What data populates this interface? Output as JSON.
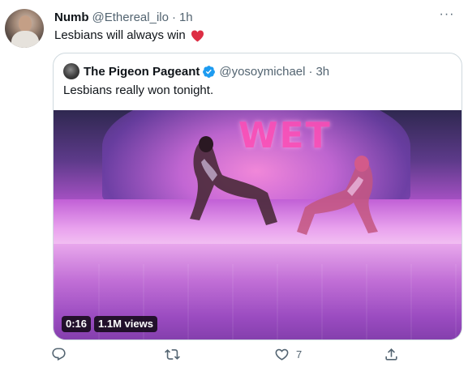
{
  "tweet": {
    "author_name": "Numb",
    "author_handle": "@Ethereal_ilo",
    "separator": "·",
    "time": "1h",
    "text": "Lesbians will always win",
    "more_glyph": "···",
    "heart_emoji_color": "#dd2e44"
  },
  "quoted_tweet": {
    "author_name": "The Pigeon Pageant",
    "author_handle": "@yosoymichael",
    "separator": "·",
    "time": "3h",
    "text": "Lesbians really won tonight.",
    "verified_color": "#1d9bf0",
    "video": {
      "duration": "0:16",
      "views": "1.1M views",
      "sign_text": "WET"
    }
  },
  "actions": {
    "reply_icon": "reply-icon",
    "retweet_icon": "retweet-icon",
    "like_icon": "heart-outline-icon",
    "like_count": "7",
    "share_icon": "share-icon"
  }
}
